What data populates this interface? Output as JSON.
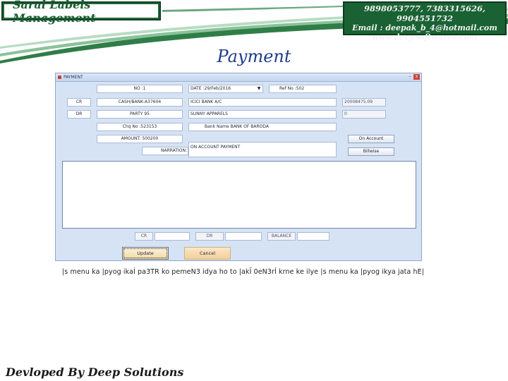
{
  "header": {
    "brand": "Saral Labels Management",
    "phones": "9898053777, 7383315626, 9904551732",
    "email": "Email : deepak_b_4@hotmail.com",
    "website": "www.deepsoftwares.com"
  },
  "page_title": "Payment",
  "window": {
    "title": "PAYMENT",
    "close_label": "x",
    "minimize_label": "–",
    "no": "NO :1",
    "date_label": "DATE :",
    "date_value": "29/Feb/2016",
    "ref_no": "Ref No :502",
    "cr_label": "CR",
    "dr_label": "DR",
    "cr_account": "CASH/BANK:A37604",
    "cr_account_name": "ICICI BANK A/C",
    "cr_balance": "20008475.09",
    "dr_account": "PARTY 95",
    "dr_account_name": "SUNNY APPARELS",
    "dr_balance": "0",
    "chq_no": "Chq No :523153",
    "bank_name": "Bank Name BANK OF BARODA",
    "amount": "AMOUNT: 500200",
    "narration_label": "NARRATION:",
    "narration_value": "ON ACCOUNT PAYMENT",
    "on_account_button": "On Account",
    "billwise_button": "Billwise",
    "totals": {
      "cr_label": "CR",
      "dr_label": "DR",
      "balance_label": "BALANCE",
      "cr_value": "",
      "dr_value": "",
      "balance_value": ""
    },
    "update_button": "Update",
    "cancel_button": "Cancel"
  },
  "caption": "|s menu ka |pyog ikaÍ pa3TR ko pemeN3 idya ho to |akÏ 0eN3rÍ krne ke ilye |s menu ka |pyog ikya jata hE|",
  "footer": "Devloped By Deep Solutions",
  "colors": {
    "brand_green": "#1a6233",
    "title_blue": "#1f3b8a",
    "window_bg": "#d6e3f5"
  }
}
